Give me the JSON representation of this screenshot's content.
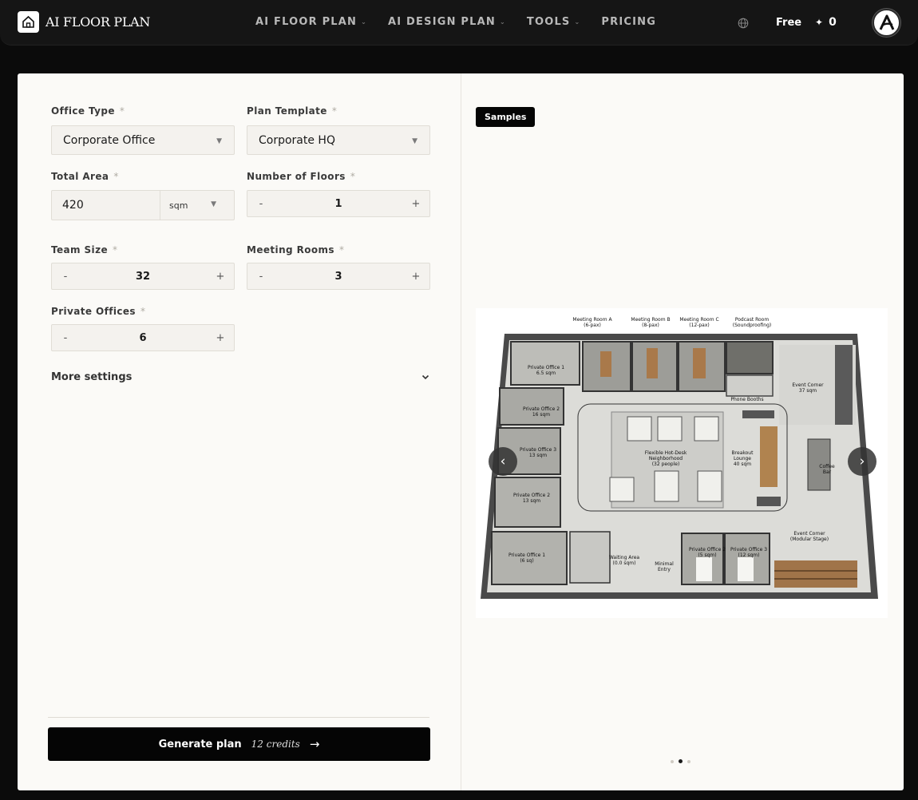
{
  "brand": {
    "name": "AI FLOOR PLAN"
  },
  "nav": {
    "items": [
      {
        "label": "AI FLOOR PLAN",
        "has_dropdown": true
      },
      {
        "label": "AI DESIGN PLAN",
        "has_dropdown": true
      },
      {
        "label": "TOOLS",
        "has_dropdown": true
      },
      {
        "label": "PRICING",
        "has_dropdown": false
      }
    ],
    "plan": "Free",
    "credits": "0"
  },
  "form": {
    "office_type": {
      "label": "Office Type",
      "value": "Corporate Office"
    },
    "plan_template": {
      "label": "Plan Template",
      "value": "Corporate HQ"
    },
    "total_area": {
      "label": "Total Area",
      "value": "420",
      "unit": "sqm"
    },
    "floors": {
      "label": "Number of Floors",
      "value": "1"
    },
    "team_size": {
      "label": "Team Size",
      "value": "32"
    },
    "meeting_rooms": {
      "label": "Meeting Rooms",
      "value": "3"
    },
    "private_offices": {
      "label": "Private Offices",
      "value": "6"
    },
    "required_mark": "*",
    "minus": "-",
    "plus": "+",
    "more_settings": "More settings",
    "generate": {
      "label": "Generate plan",
      "cost": "12 credits",
      "arrow": "→"
    }
  },
  "preview": {
    "badge": "Samples",
    "prev": "‹",
    "next": "›",
    "slide_count": 3,
    "active_slide": 2,
    "plan_labels": {
      "mra": "Meeting Room A",
      "mra_cap": "(6-pax)",
      "mrb": "Meeting Room B",
      "mrb_cap": "(8-pax)",
      "mrc": "Meeting Room C",
      "mrc_cap": "(12-pax)",
      "pod": "Podcast Room",
      "pod_cap": "(Soundproofing)",
      "po1": "Private Office 1",
      "po1_a": "6.5 sqm",
      "po2": "Private Office 2",
      "po2_a": "16 sqm",
      "po3": "Private Office 3",
      "po3_a": "13 sqm",
      "po4": "Private Office 2",
      "po4_a": "13 sqm",
      "po5": "Private Office 1",
      "po5_a": "(6 sq)",
      "phone": "Phone Booths",
      "event1": "Event Corner",
      "event1_a": "37 sqm",
      "hotdesk1": "Flexible Hot-Desk",
      "hotdesk2": "Neighborhood",
      "hotdesk3": "(32 people)",
      "breakout1": "Breakout",
      "breakout2": "Lounge",
      "breakout3": "40 sqm",
      "coffee1": "Coffee",
      "coffee2": "Bar",
      "event2": "Event Corner",
      "event2_a": "(Modular Stage)",
      "waiting": "Waiting Area",
      "waiting_a": "(0.0 sqm)",
      "entry1": "Minimal",
      "entry2": "Entry",
      "po6": "Private Office 2",
      "po6_a": "(5 sqm)",
      "po7": "Private Office 3",
      "po7_a": "(12 sqm)"
    }
  }
}
